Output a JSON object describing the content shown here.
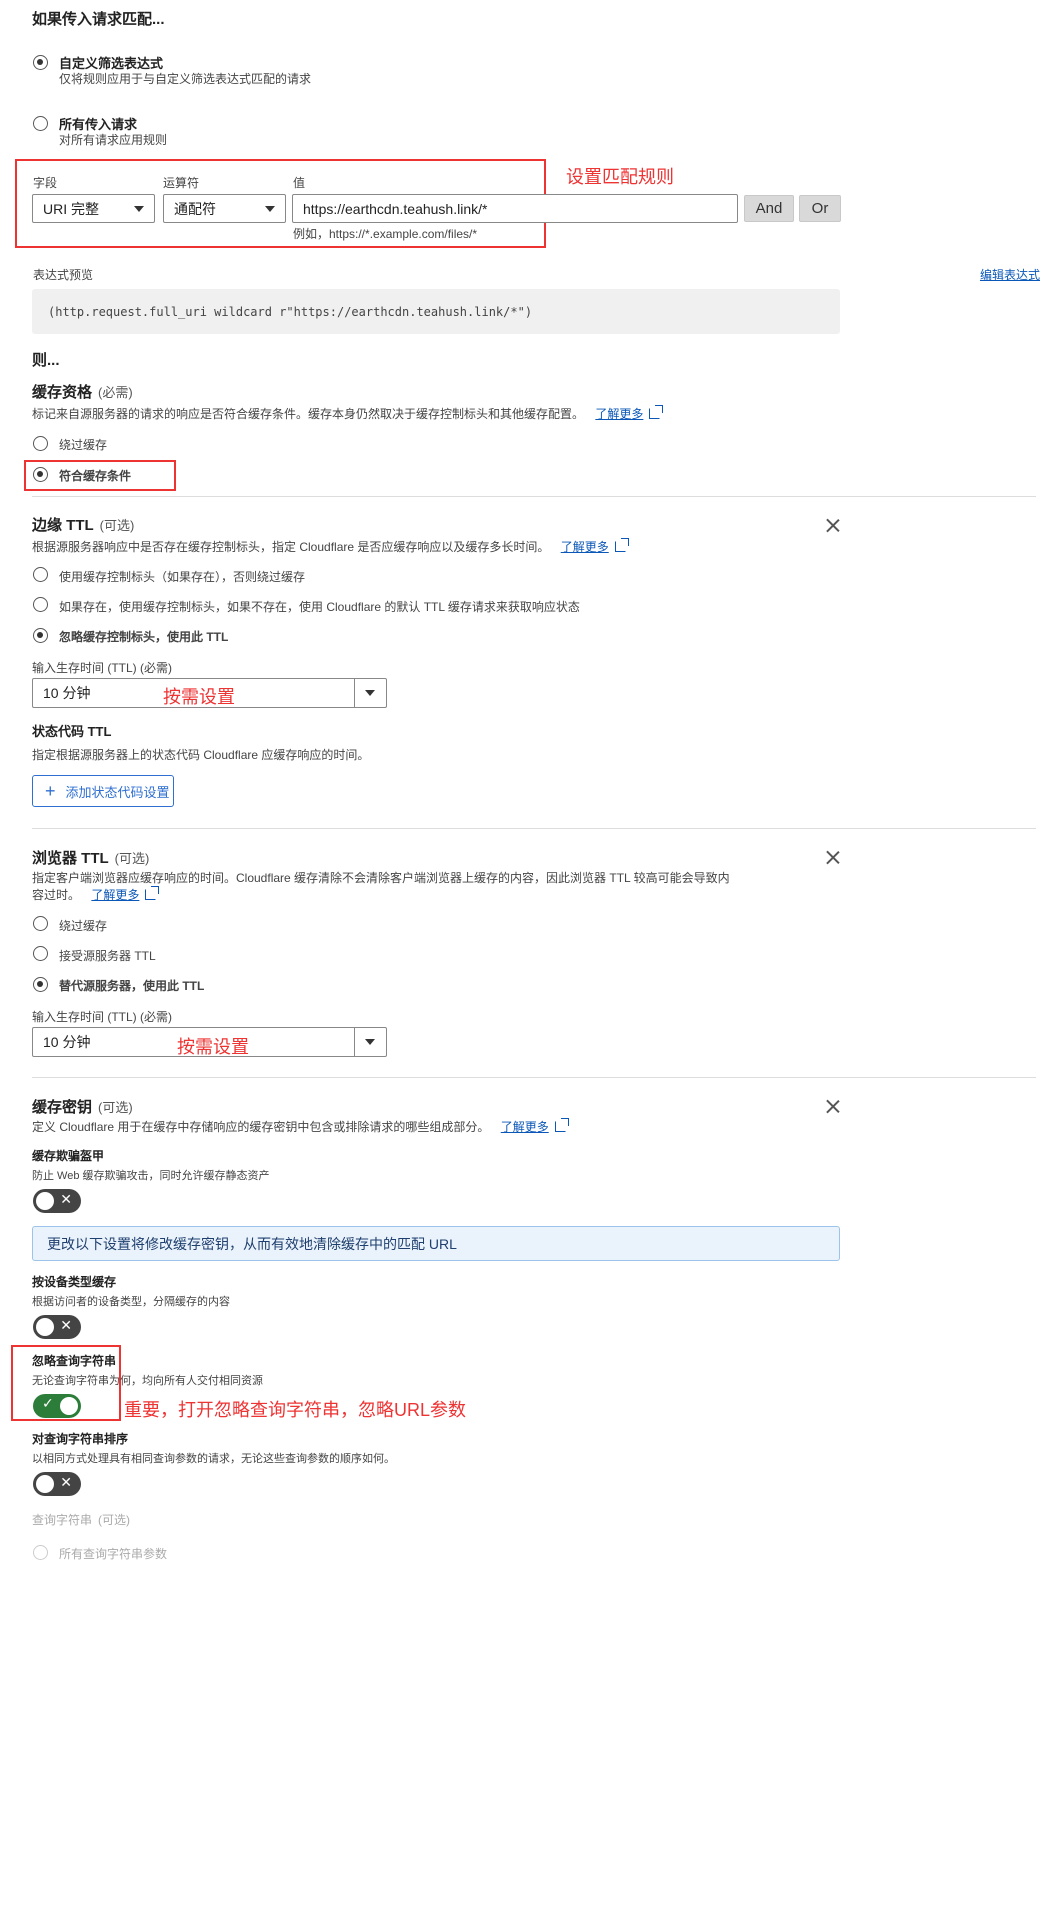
{
  "heading": "如果传入请求匹配...",
  "match_options": [
    {
      "title": "自定义筛选表达式",
      "desc": "仅将规则应用于与自定义筛选表达式匹配的请求",
      "selected": true
    },
    {
      "title": "所有传入请求",
      "desc": "对所有请求应用规则",
      "selected": false
    }
  ],
  "filter": {
    "field_label": "字段",
    "field_value": "URI 完整",
    "operator_label": "运算符",
    "operator_value": "通配符",
    "value_label": "值",
    "value_value": "https://earthcdn.teahush.link/*",
    "value_hint": "例如，https://*.example.com/files/*",
    "and_label": "And",
    "or_label": "Or"
  },
  "annotations": {
    "match_rule": "设置匹配规则",
    "edge_ttl_hint": "按需设置",
    "browser_ttl_hint": "按需设置",
    "ignore_query": "重要，打开忽略查询字符串，忽略URL参数"
  },
  "expression": {
    "label": "表达式预览",
    "edit_link": "编辑表达式",
    "code": "(http.request.full_uri wildcard r\"https://earthcdn.teahush.link/*\")"
  },
  "then_label": "则...",
  "cache_eligibility": {
    "title": "缓存资格",
    "optional": "(必需)",
    "desc": "标记来自源服务器的请求的响应是否符合缓存条件。缓存本身仍然取决于缓存控制标头和其他缓存配置。",
    "learn_more": "了解更多",
    "options": [
      {
        "label": "绕过缓存",
        "selected": false
      },
      {
        "label": "符合缓存条件",
        "selected": true
      }
    ]
  },
  "edge_ttl": {
    "title": "边缘 TTL",
    "optional": "(可选)",
    "desc": "根据源服务器响应中是否存在缓存控制标头，指定 Cloudflare 是否应缓存响应以及缓存多长时间。",
    "learn_more": "了解更多",
    "options": [
      {
        "label": "使用缓存控制标头（如果存在），否则绕过缓存",
        "selected": false
      },
      {
        "label": "如果存在，使用缓存控制标头，如果不存在，使用 Cloudflare 的默认 TTL 缓存请求来获取响应状态",
        "selected": false
      },
      {
        "label": "忽略缓存控制标头，使用此 TTL",
        "selected": true
      }
    ],
    "ttl_label": "输入生存时间 (TTL) (必需)",
    "ttl_value": "10 分钟",
    "status_title": "状态代码 TTL",
    "status_desc": "指定根据源服务器上的状态代码 Cloudflare 应缓存响应的时间。",
    "add_status_button": "添加状态代码设置"
  },
  "browser_ttl": {
    "title": "浏览器 TTL",
    "optional": "(可选)",
    "desc_line1": "指定客户端浏览器应缓存响应的时间。Cloudflare 缓存清除不会清除客户端浏览器上缓存的内容，因此浏览器 TTL 较高可能会导致内",
    "desc_line2": "容过时。",
    "learn_more": "了解更多",
    "options": [
      {
        "label": "绕过缓存",
        "selected": false
      },
      {
        "label": "接受源服务器 TTL",
        "selected": false
      },
      {
        "label": "替代源服务器，使用此 TTL",
        "selected": true
      }
    ],
    "ttl_label": "输入生存时间 (TTL) (必需)",
    "ttl_value": "10 分钟"
  },
  "cache_key": {
    "title": "缓存密钥",
    "optional": "(可选)",
    "desc": "定义 Cloudflare 用于在缓存中存储响应的缓存密钥中包含或排除请求的哪些组成部分。",
    "learn_more": "了解更多",
    "deception_title": "缓存欺骗盔甲",
    "deception_desc": "防止 Web 缓存欺骗攻击，同时允许缓存静态资产",
    "info_banner": "更改以下设置将修改缓存密钥，从而有效地清除缓存中的匹配 URL",
    "device_title": "按设备类型缓存",
    "device_desc": "根据访问者的设备类型，分隔缓存的内容",
    "ignore_title": "忽略查询字符串",
    "ignore_desc": "无论查询字符串为何，均向所有人交付相同资源",
    "sort_title": "对查询字符串排序",
    "sort_desc": "以相同方式处理具有相同查询参数的请求，无论这些查询参数的顺序如何。",
    "query_label": "查询字符串",
    "query_optional": "(可选)",
    "all_params": "所有查询字符串参数"
  }
}
